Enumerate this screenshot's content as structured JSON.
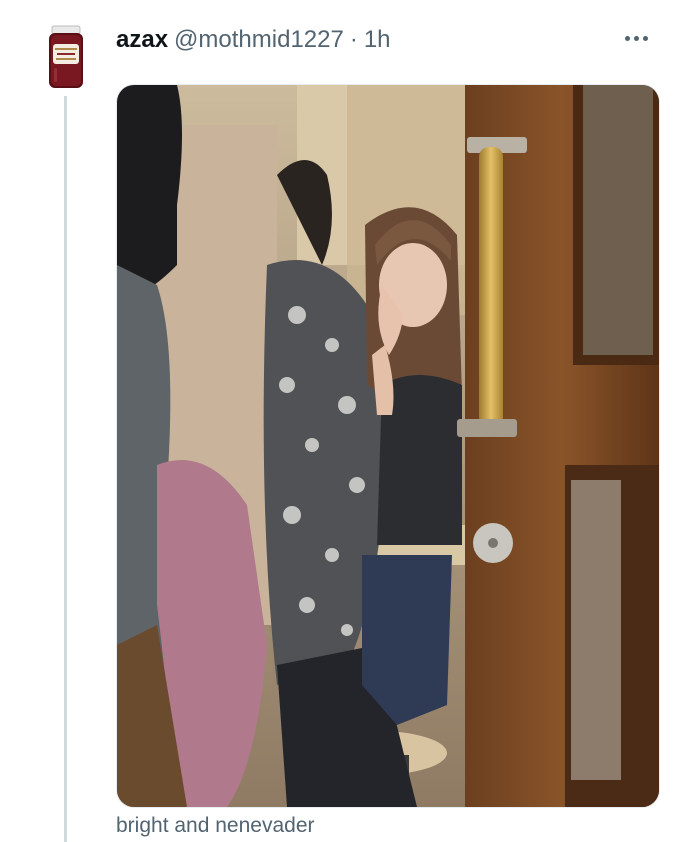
{
  "tweet": {
    "display_name": "azax",
    "handle": "@mothmid1227",
    "separator": "·",
    "time": "1h",
    "more_icon": "more-horizontal-icon",
    "caption": "bright and nenevader"
  },
  "colors": {
    "text": "#0f1419",
    "secondary": "#536471",
    "thread_line": "#cfd9de"
  }
}
